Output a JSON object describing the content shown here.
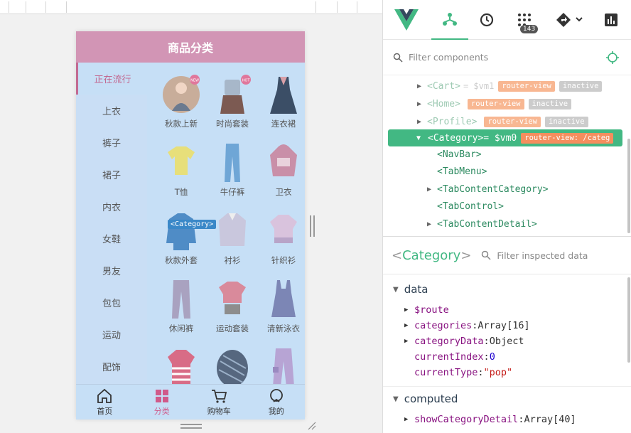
{
  "app": {
    "nav_title": "商品分类",
    "menu": [
      "正在流行",
      "上衣",
      "裤子",
      "裙子",
      "内衣",
      "女鞋",
      "男友",
      "包包",
      "运动",
      "配饰"
    ],
    "grid": [
      {
        "label": "秋款上新",
        "icon": "model-photo-icon",
        "color": "#c8a58a",
        "badge": "NEW"
      },
      {
        "label": "时尚套装",
        "icon": "outfit-set-icon",
        "color": "#a7b7c9",
        "badge": "HOT"
      },
      {
        "label": "连衣裙",
        "icon": "dress-icon",
        "color": "#3b4e66"
      },
      {
        "label": "T恤",
        "icon": "tshirt-icon",
        "color": "#e7df7a"
      },
      {
        "label": "牛仔裤",
        "icon": "jeans-icon",
        "color": "#6fa6d6"
      },
      {
        "label": "卫衣",
        "icon": "hoodie-icon",
        "color": "#c98fa8"
      },
      {
        "label": "秋款外套",
        "icon": "jacket-icon",
        "color": "#4f8cc6"
      },
      {
        "label": "衬衫",
        "icon": "shirt-icon",
        "color": "#c9c7dd"
      },
      {
        "label": "针织衫",
        "icon": "knit-sweater-icon",
        "color": "#d9c3dd"
      },
      {
        "label": "休闲裤",
        "icon": "pants-icon",
        "color": "#a9a2c0"
      },
      {
        "label": "运动套装",
        "icon": "sports-set-icon",
        "color": "#d98a9b"
      },
      {
        "label": "清新泳衣",
        "icon": "swimsuit-icon",
        "color": "#7c86b5"
      },
      {
        "label": "",
        "icon": "striped-shirt-icon",
        "color": "#d86c86"
      },
      {
        "label": "",
        "icon": "striped-coat-icon",
        "color": "#56677f"
      },
      {
        "label": "",
        "icon": "cargo-pants-icon",
        "color": "#b7a4d4"
      }
    ],
    "tabs": [
      {
        "label": "首页",
        "icon": "home-icon"
      },
      {
        "label": "分类",
        "icon": "category-icon"
      },
      {
        "label": "购物车",
        "icon": "cart-icon"
      },
      {
        "label": "我的",
        "icon": "profile-icon"
      }
    ],
    "tooltip": "<Category>"
  },
  "devtools": {
    "badge": "143",
    "filter_placeholder": "Filter components",
    "tree": [
      {
        "name": "<Cart>",
        "vm": "= $vm1",
        "tags": [
          "router-view",
          "inactive"
        ]
      },
      {
        "name": "<Home>",
        "vm": "",
        "tags": [
          "router-view",
          "inactive"
        ]
      },
      {
        "name": "<Profile>",
        "vm": "",
        "tags": [
          "router-view",
          "inactive"
        ]
      }
    ],
    "selected": {
      "name": "<Category>",
      "vm": " = $vm0",
      "tag": "router-view: /categ"
    },
    "children": [
      "<NavBar>",
      "<TabMenu>",
      "<TabContentCategory>",
      "<TabControl>",
      "<TabContentDetail>"
    ],
    "inspect_title": "Category",
    "inspect_open": "<",
    "inspect_close": ">",
    "inspect_placeholder": "Filter inspected data",
    "sections": {
      "data": "data",
      "computed": "computed"
    },
    "data_rows": [
      {
        "key": "$route",
        "sep": "",
        "val": "",
        "expand": true
      },
      {
        "key": "categories",
        "sep": ": ",
        "val": "Array[16]",
        "expand": true
      },
      {
        "key": "categoryData",
        "sep": ": ",
        "val": "Object",
        "expand": true
      },
      {
        "key": "currentIndex",
        "sep": ": ",
        "val": "0",
        "expand": false
      },
      {
        "key": "currentType",
        "sep": ": ",
        "val": "\"pop\"",
        "expand": false
      }
    ],
    "computed_rows": [
      {
        "key": "showCategoryDetail",
        "sep": ": ",
        "val": "Array[40]",
        "expand": true
      }
    ]
  },
  "colors": {
    "accent": "#42b883",
    "nav": "#d295b5",
    "active": "#c26a92"
  }
}
